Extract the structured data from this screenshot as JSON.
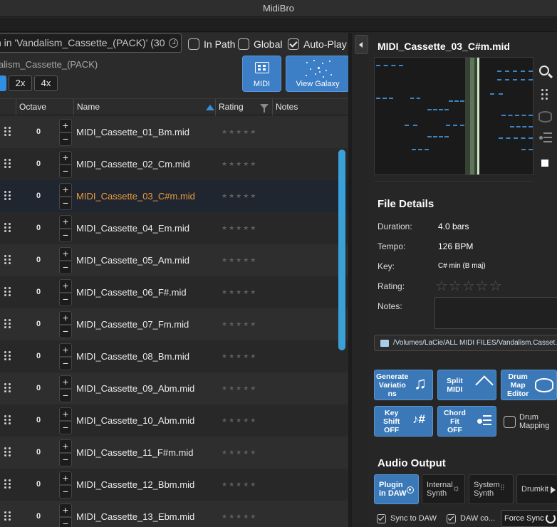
{
  "window": {
    "title": "MidiBro"
  },
  "browser": {
    "search_value": "h in 'Vandalism_Cassette_(PACK)' (30",
    "options": [
      {
        "label": "In Path",
        "checked": false
      },
      {
        "label": "Global",
        "checked": false
      },
      {
        "label": "Auto-Play",
        "checked": true
      }
    ],
    "pack_name": "alism_Cassette_(PACK)",
    "zoom_options": [
      "2x",
      "4x"
    ],
    "midi_button": "MIDI",
    "galaxy_button": "View Galaxy"
  },
  "table": {
    "headers": {
      "octave": "Octave",
      "name": "Name",
      "rating": "Rating",
      "notes": "Notes"
    },
    "rating_stars": "★★★★★",
    "rows": [
      {
        "octave": "0",
        "name": "MIDI_Cassette_01_Bm.mid",
        "selected": false
      },
      {
        "octave": "0",
        "name": "MIDI_Cassette_02_Cm.mid",
        "selected": false
      },
      {
        "octave": "0",
        "name": "MIDI_Cassette_03_C#m.mid",
        "selected": true
      },
      {
        "octave": "0",
        "name": "MIDI_Cassette_04_Em.mid",
        "selected": false
      },
      {
        "octave": "0",
        "name": "MIDI_Cassette_05_Am.mid",
        "selected": false
      },
      {
        "octave": "0",
        "name": "MIDI_Cassette_06_F#.mid",
        "selected": false
      },
      {
        "octave": "0",
        "name": "MIDI_Cassette_07_Fm.mid",
        "selected": false
      },
      {
        "octave": "0",
        "name": "MIDI_Cassette_08_Bm.mid",
        "selected": false
      },
      {
        "octave": "0",
        "name": "MIDI_Cassette_09_Abm.mid",
        "selected": false
      },
      {
        "octave": "0",
        "name": "MIDI_Cassette_10_Abm.mid",
        "selected": false
      },
      {
        "octave": "0",
        "name": "MIDI_Cassette_11_F#m.mid",
        "selected": false
      },
      {
        "octave": "0",
        "name": "MIDI_Cassette_12_Bbm.mid",
        "selected": false
      },
      {
        "octave": "0",
        "name": "MIDI_Cassette_13_Ebm.mid",
        "selected": false
      }
    ],
    "stepper_plus": "+",
    "stepper_minus": "−"
  },
  "details": {
    "file_title": "MIDI_Cassette_03_C#m.mid",
    "section_title": "File Details",
    "duration_label": "Duration:",
    "duration_value": "4.0 bars",
    "tempo_label": "Tempo:",
    "tempo_value": "126 BPM",
    "key_label": "Key:",
    "key_value": "C# min (B maj)",
    "rating_label": "Rating:",
    "rating_stars": "☆☆☆☆☆",
    "notes_label": "Notes:",
    "path": "/Volumes/LaCie/ALL MIDI FILES/Vandalism.Casset..."
  },
  "tools": {
    "generate": "Generate\nVariatio\nns",
    "split": "Split\nMIDI",
    "drum_map": "Drum\nMap\nEditor",
    "key_shift": "Key\nShift\nOFF",
    "chord_fit": "Chord\nFit\nOFF",
    "drum_mapping": "Drum\nMapping"
  },
  "audio": {
    "section_title": "Audio Output",
    "plugin": "Plugin\nin DAW",
    "internal": "Internal\nSynth",
    "system": "System\nSynth",
    "drumkit": "Drumkit",
    "sync_to_daw": "Sync to DAW",
    "daw_control": "DAW co...",
    "force_sync": "Force Sync"
  },
  "colors": {
    "accent": "#3d7fc6",
    "selected_text": "#ee9a3a",
    "scrollbar": "#3aa0d8"
  }
}
